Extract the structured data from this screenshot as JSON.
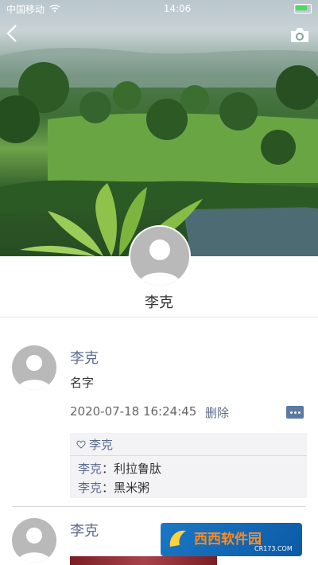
{
  "status_bar": {
    "carrier": "中国移动",
    "time": "14:06",
    "battery_icon": "battery-icon",
    "wifi_icon": "wifi-icon"
  },
  "nav": {
    "back_icon": "chevron-left-icon",
    "camera_icon": "camera-icon"
  },
  "profile": {
    "name": "李克"
  },
  "posts": [
    {
      "author": "李克",
      "text": "名字",
      "time": "2020-07-18 16:24:45",
      "delete_label": "删除",
      "likes": {
        "icon": "heart-icon",
        "names": "李克"
      },
      "comments": [
        {
          "author": "李克",
          "sep": "：",
          "text": "利拉鲁肽"
        },
        {
          "author": "李克",
          "sep": "：",
          "text": "黑米粥"
        }
      ]
    },
    {
      "author": "李克"
    }
  ],
  "watermark": {
    "brand": "西西软件园",
    "url": "CR173.COM"
  },
  "colors": {
    "link": "#5b6b8c",
    "action_button": "#5b7aa5",
    "battery_fill": "#4cd964"
  }
}
